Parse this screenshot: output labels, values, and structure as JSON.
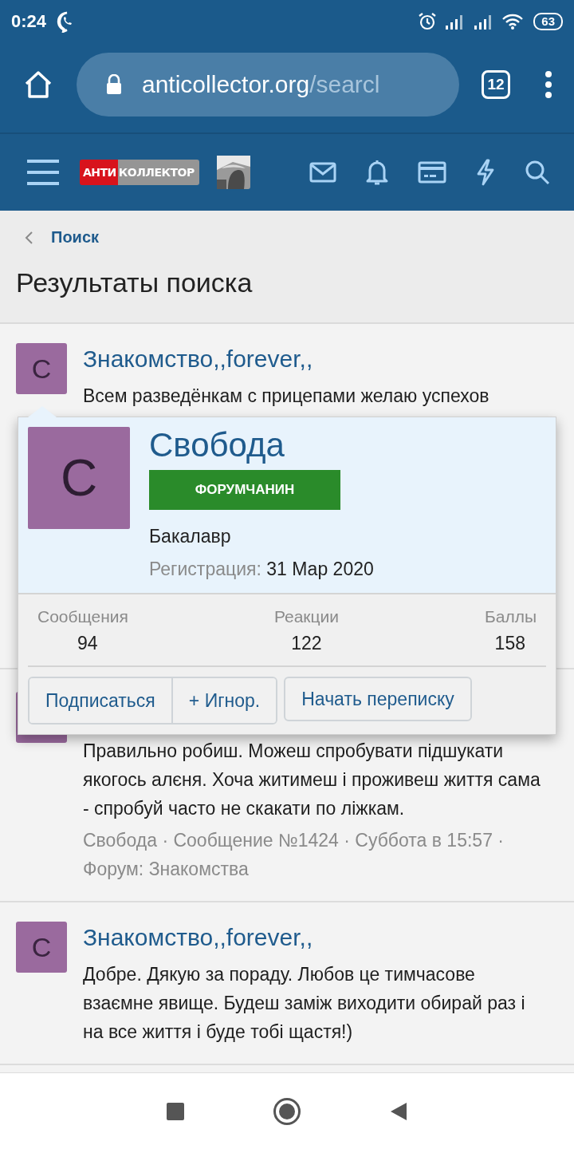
{
  "status_bar": {
    "time": "0:24",
    "battery": "63"
  },
  "browser": {
    "url_host": "anticollector.org",
    "url_path": "/searcl",
    "tab_count": "12"
  },
  "site_header": {
    "logo_red": "АНТИ",
    "logo_grey": "КОЛЛЕКТОР"
  },
  "breadcrumb": {
    "label": "Поиск"
  },
  "page_title": "Результаты поиска",
  "results": [
    {
      "avatar_letter": "С",
      "title": "Знакомство,,forever,,",
      "snippet": "Всем разведёнкам с прицепами желаю успехов"
    },
    {
      "snippet": "Правильно робиш. Можеш спробувати підшукати якогось алєня. Хоча житимеш і проживеш життя сама - спробуй часто не скакати по ліжкам.",
      "meta": "Свобода · Сообщение №1424 · Суббота в 15:57 · Форум: Знакомства"
    },
    {
      "avatar_letter": "С",
      "title": "Знакомство,,forever,,",
      "snippet": "Добре. Дякую за пораду. Любов це тимчасове взаємне явище. Будеш заміж виходити обирай раз і на все життя і буде тобі щастя!)"
    }
  ],
  "member_popup": {
    "avatar_letter": "С",
    "name": "Свобода",
    "badge": "ФОРУМЧАНИН",
    "user_title": "Бакалавр",
    "registered_label": "Регистрация:",
    "registered_value": "31 Мар 2020",
    "stats": [
      {
        "label": "Сообщения",
        "value": "94"
      },
      {
        "label": "Реакции",
        "value": "122"
      },
      {
        "label": "Баллы",
        "value": "158"
      }
    ],
    "buttons": [
      "Подписаться",
      "+ Игнор.",
      "Начать переписку"
    ]
  }
}
